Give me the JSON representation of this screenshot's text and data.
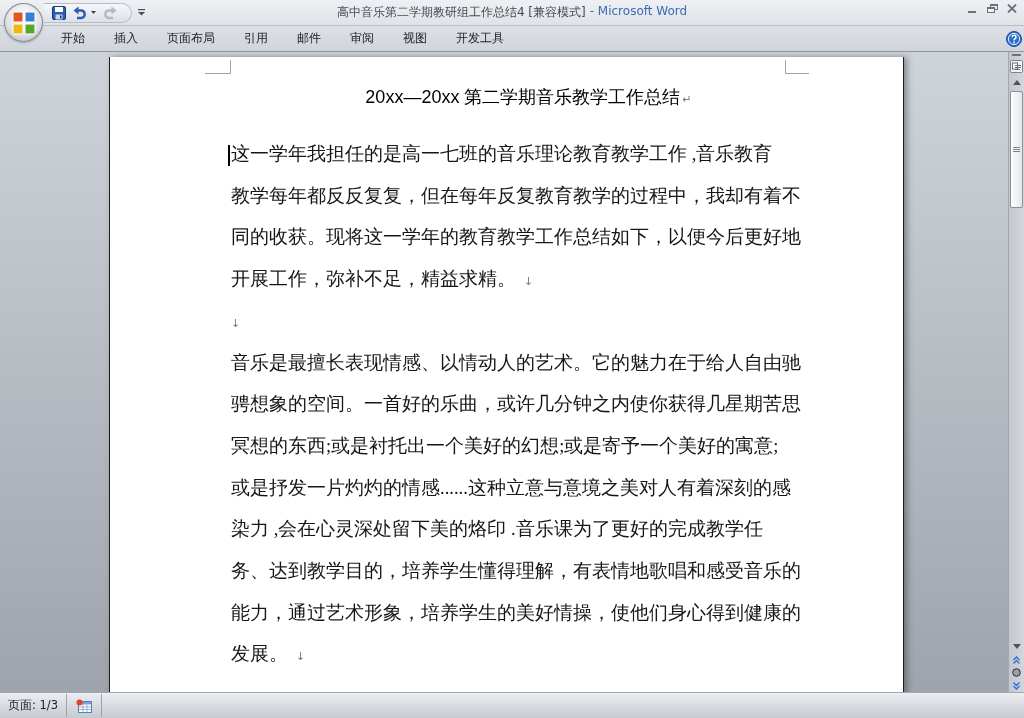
{
  "window": {
    "document_name": "高中音乐第二学期教研组工作总结4 [兼容模式]",
    "app_suffix": "- Microsoft Word"
  },
  "quick_access_toolbar": [
    {
      "kind": "save",
      "disabled": false
    },
    {
      "kind": "undo",
      "disabled": false
    },
    {
      "kind": "redo",
      "disabled": true
    }
  ],
  "ribbon_tabs": [
    {
      "label": "开始",
      "selected": false
    },
    {
      "label": "插入",
      "selected": false
    },
    {
      "label": "页面布局",
      "selected": false
    },
    {
      "label": "引用",
      "selected": false
    },
    {
      "label": "邮件",
      "selected": false
    },
    {
      "label": "审阅",
      "selected": false
    },
    {
      "label": "视图",
      "selected": false
    },
    {
      "label": "开发工具",
      "selected": false
    }
  ],
  "document": {
    "title": "20xx—20xx 第二学期音乐教学工作总结",
    "title_end_mark": "↵",
    "paragraphs": [
      {
        "lines": [
          "这一学年我担任的是高一七班的音乐理论教育教学工作 ,音乐教育",
          "教学每年都反反复复，但在每年反复教育教学的过程中，我却有着不",
          "同的收获。现将这一学年的教育教学工作总结如下，以便今后更好地",
          "开展工作，弥补不足，精益求精。"
        ],
        "end_mark": "↓",
        "cursor": true
      },
      {
        "end_mark": "↓",
        "cursor": false
      },
      {
        "lines": [
          "音乐是最擅长表现情感、以情动人的艺术。它的魅力在于给人自由驰",
          "骋想象的空间。一首好的乐曲，或许几分钟之内使你获得几星期苦思",
          "冥想的东西;或是衬托出一个美好的幻想;或是寄予一个美好的寓意;",
          "或是抒发一片灼灼的情感......这种立意与意境之美对人有着深刻的感",
          "染力 ,会在心灵深处留下美的烙印 .音乐课为了更好的完成教学任",
          "务、达到教学目的，培养学生懂得理解，有表情地歌唱和感受音乐的",
          "能力，通过艺术形象，培养学生的美好情操，使他们身心得到健康的",
          "发展。"
        ],
        "end_mark": "↓",
        "cursor": false
      }
    ]
  },
  "status_bar": {
    "page": "页面: 1/3"
  }
}
